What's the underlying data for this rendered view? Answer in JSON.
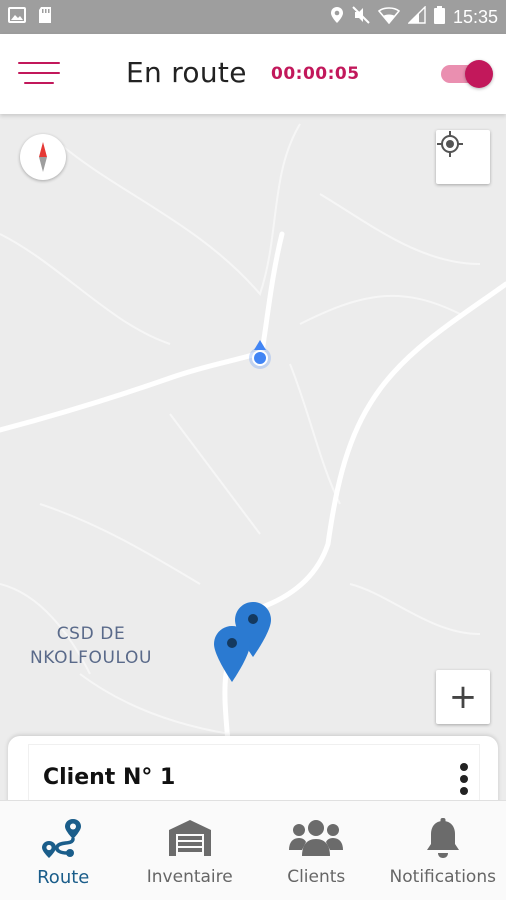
{
  "statusbar": {
    "time": "15:35",
    "icons": [
      "image-icon",
      "sd-card-icon",
      "location-icon",
      "mute-icon",
      "wifi-icon",
      "signal-icon",
      "battery-icon"
    ]
  },
  "header": {
    "title": "En route",
    "timer": "00:00:05",
    "toggle_on": true,
    "accent_color": "#c2185b"
  },
  "map": {
    "place_label_line1": "CSD DE",
    "place_label_line2": "NKOLFOULOU",
    "zoom_in_label": "+",
    "pin_color": "#2b7ad1",
    "user_dot_color": "#4285f4"
  },
  "card": {
    "title": "Client N° 1"
  },
  "nav": {
    "items": [
      {
        "label": "Route",
        "icon": "route-icon",
        "active": true
      },
      {
        "label": "Inventaire",
        "icon": "garage-icon",
        "active": false
      },
      {
        "label": "Clients",
        "icon": "users-icon",
        "active": false
      },
      {
        "label": "Notifications",
        "icon": "bell-icon",
        "active": false
      }
    ],
    "active_color": "#1a5d8a"
  }
}
